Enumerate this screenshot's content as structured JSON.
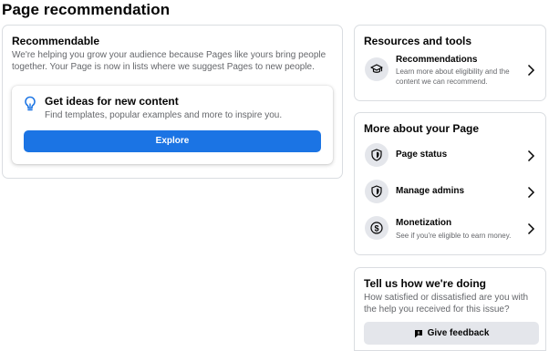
{
  "page": {
    "title": "Page recommendation"
  },
  "recommendable": {
    "heading": "Recommendable",
    "description": "We're helping you grow your audience because Pages like yours bring people together. Your Page is now in lists where we suggest Pages to new people.",
    "ideas": {
      "icon": "lightbulb-icon",
      "title": "Get ideas for new content",
      "subtitle": "Find templates, popular examples and more to inspire you.",
      "button_label": "Explore"
    }
  },
  "resources": {
    "heading": "Resources and tools",
    "items": [
      {
        "icon": "graduation-cap-icon",
        "label": "Recommendations",
        "description": "Learn more about eligibility and the content we can recommend."
      }
    ]
  },
  "more_about": {
    "heading": "More about your Page",
    "items": [
      {
        "icon": "shield-icon",
        "label": "Page status"
      },
      {
        "icon": "shield-icon",
        "label": "Manage admins"
      },
      {
        "icon": "dollar-icon",
        "label": "Monetization",
        "description": "See if you're eligible to earn money."
      }
    ]
  },
  "feedback": {
    "heading": "Tell us how we're doing",
    "question": "How satisfied or dissatisfied are you with the help you received for this issue?",
    "button_icon": "feedback-icon",
    "button_label": "Give feedback"
  },
  "colors": {
    "primary": "#1b74e4",
    "secondary_text": "#65676b",
    "border": "#dadde1",
    "icon_bg": "#e4e6eb"
  }
}
